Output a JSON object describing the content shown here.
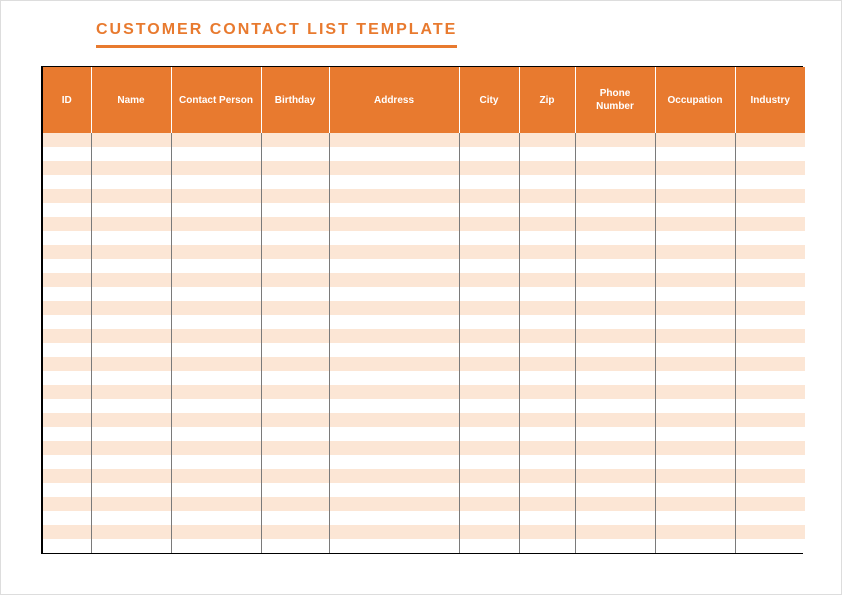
{
  "title": "CUSTOMER CONTACT LIST TEMPLATE",
  "colors": {
    "accent": "#E87A2F",
    "row_alt": "#FCE6D5"
  },
  "columns": [
    {
      "label": "ID"
    },
    {
      "label": "Name"
    },
    {
      "label": "Contact Person"
    },
    {
      "label": "Birthday"
    },
    {
      "label": "Address"
    },
    {
      "label": "City"
    },
    {
      "label": "Zip"
    },
    {
      "label": "Phone Number"
    },
    {
      "label": "Occupation"
    },
    {
      "label": "Industry"
    }
  ],
  "rows": [
    {
      "id": "",
      "name": "",
      "contact_person": "",
      "birthday": "",
      "address": "",
      "city": "",
      "zip": "",
      "phone": "",
      "occupation": "",
      "industry": ""
    },
    {
      "id": "",
      "name": "",
      "contact_person": "",
      "birthday": "",
      "address": "",
      "city": "",
      "zip": "",
      "phone": "",
      "occupation": "",
      "industry": ""
    },
    {
      "id": "",
      "name": "",
      "contact_person": "",
      "birthday": "",
      "address": "",
      "city": "",
      "zip": "",
      "phone": "",
      "occupation": "",
      "industry": ""
    },
    {
      "id": "",
      "name": "",
      "contact_person": "",
      "birthday": "",
      "address": "",
      "city": "",
      "zip": "",
      "phone": "",
      "occupation": "",
      "industry": ""
    },
    {
      "id": "",
      "name": "",
      "contact_person": "",
      "birthday": "",
      "address": "",
      "city": "",
      "zip": "",
      "phone": "",
      "occupation": "",
      "industry": ""
    },
    {
      "id": "",
      "name": "",
      "contact_person": "",
      "birthday": "",
      "address": "",
      "city": "",
      "zip": "",
      "phone": "",
      "occupation": "",
      "industry": ""
    },
    {
      "id": "",
      "name": "",
      "contact_person": "",
      "birthday": "",
      "address": "",
      "city": "",
      "zip": "",
      "phone": "",
      "occupation": "",
      "industry": ""
    },
    {
      "id": "",
      "name": "",
      "contact_person": "",
      "birthday": "",
      "address": "",
      "city": "",
      "zip": "",
      "phone": "",
      "occupation": "",
      "industry": ""
    },
    {
      "id": "",
      "name": "",
      "contact_person": "",
      "birthday": "",
      "address": "",
      "city": "",
      "zip": "",
      "phone": "",
      "occupation": "",
      "industry": ""
    },
    {
      "id": "",
      "name": "",
      "contact_person": "",
      "birthday": "",
      "address": "",
      "city": "",
      "zip": "",
      "phone": "",
      "occupation": "",
      "industry": ""
    },
    {
      "id": "",
      "name": "",
      "contact_person": "",
      "birthday": "",
      "address": "",
      "city": "",
      "zip": "",
      "phone": "",
      "occupation": "",
      "industry": ""
    },
    {
      "id": "",
      "name": "",
      "contact_person": "",
      "birthday": "",
      "address": "",
      "city": "",
      "zip": "",
      "phone": "",
      "occupation": "",
      "industry": ""
    },
    {
      "id": "",
      "name": "",
      "contact_person": "",
      "birthday": "",
      "address": "",
      "city": "",
      "zip": "",
      "phone": "",
      "occupation": "",
      "industry": ""
    },
    {
      "id": "",
      "name": "",
      "contact_person": "",
      "birthday": "",
      "address": "",
      "city": "",
      "zip": "",
      "phone": "",
      "occupation": "",
      "industry": ""
    },
    {
      "id": "",
      "name": "",
      "contact_person": "",
      "birthday": "",
      "address": "",
      "city": "",
      "zip": "",
      "phone": "",
      "occupation": "",
      "industry": ""
    },
    {
      "id": "",
      "name": "",
      "contact_person": "",
      "birthday": "",
      "address": "",
      "city": "",
      "zip": "",
      "phone": "",
      "occupation": "",
      "industry": ""
    },
    {
      "id": "",
      "name": "",
      "contact_person": "",
      "birthday": "",
      "address": "",
      "city": "",
      "zip": "",
      "phone": "",
      "occupation": "",
      "industry": ""
    },
    {
      "id": "",
      "name": "",
      "contact_person": "",
      "birthday": "",
      "address": "",
      "city": "",
      "zip": "",
      "phone": "",
      "occupation": "",
      "industry": ""
    },
    {
      "id": "",
      "name": "",
      "contact_person": "",
      "birthday": "",
      "address": "",
      "city": "",
      "zip": "",
      "phone": "",
      "occupation": "",
      "industry": ""
    },
    {
      "id": "",
      "name": "",
      "contact_person": "",
      "birthday": "",
      "address": "",
      "city": "",
      "zip": "",
      "phone": "",
      "occupation": "",
      "industry": ""
    },
    {
      "id": "",
      "name": "",
      "contact_person": "",
      "birthday": "",
      "address": "",
      "city": "",
      "zip": "",
      "phone": "",
      "occupation": "",
      "industry": ""
    },
    {
      "id": "",
      "name": "",
      "contact_person": "",
      "birthday": "",
      "address": "",
      "city": "",
      "zip": "",
      "phone": "",
      "occupation": "",
      "industry": ""
    },
    {
      "id": "",
      "name": "",
      "contact_person": "",
      "birthday": "",
      "address": "",
      "city": "",
      "zip": "",
      "phone": "",
      "occupation": "",
      "industry": ""
    },
    {
      "id": "",
      "name": "",
      "contact_person": "",
      "birthday": "",
      "address": "",
      "city": "",
      "zip": "",
      "phone": "",
      "occupation": "",
      "industry": ""
    },
    {
      "id": "",
      "name": "",
      "contact_person": "",
      "birthday": "",
      "address": "",
      "city": "",
      "zip": "",
      "phone": "",
      "occupation": "",
      "industry": ""
    },
    {
      "id": "",
      "name": "",
      "contact_person": "",
      "birthday": "",
      "address": "",
      "city": "",
      "zip": "",
      "phone": "",
      "occupation": "",
      "industry": ""
    },
    {
      "id": "",
      "name": "",
      "contact_person": "",
      "birthday": "",
      "address": "",
      "city": "",
      "zip": "",
      "phone": "",
      "occupation": "",
      "industry": ""
    },
    {
      "id": "",
      "name": "",
      "contact_person": "",
      "birthday": "",
      "address": "",
      "city": "",
      "zip": "",
      "phone": "",
      "occupation": "",
      "industry": ""
    },
    {
      "id": "",
      "name": "",
      "contact_person": "",
      "birthday": "",
      "address": "",
      "city": "",
      "zip": "",
      "phone": "",
      "occupation": "",
      "industry": ""
    },
    {
      "id": "",
      "name": "",
      "contact_person": "",
      "birthday": "",
      "address": "",
      "city": "",
      "zip": "",
      "phone": "",
      "occupation": "",
      "industry": ""
    }
  ]
}
